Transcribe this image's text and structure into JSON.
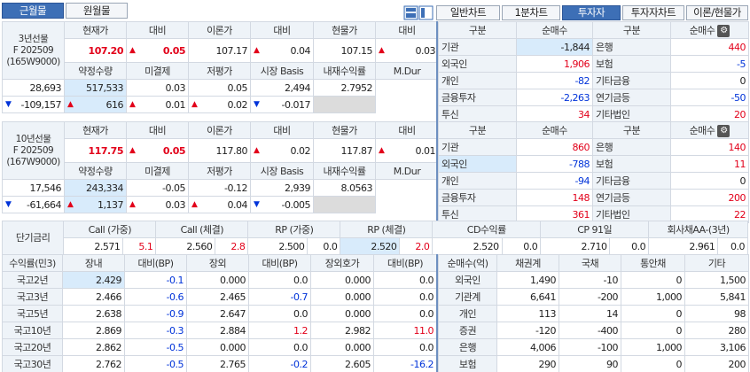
{
  "tabs": {
    "left": [
      "근월물",
      "원월물"
    ],
    "right": [
      "일반차트",
      "1분차트",
      "투자자",
      "투자자차트",
      "이론/현물가"
    ]
  },
  "sec1": {
    "name": "3년선물",
    "sub1": "F 202509",
    "sub2": "(165W9000)",
    "h1": [
      "현재가",
      "대비",
      "이론가",
      "대비",
      "현물가",
      "대비"
    ],
    "r1": [
      "107.20",
      "0.05",
      "107.17",
      "0.04",
      "107.15",
      "0.03"
    ],
    "h2": [
      "약정수량",
      "미결제",
      "저평가",
      "시장 Basis",
      "내재수익률",
      "M.Dur"
    ],
    "r2": [
      "28,693",
      "517,533",
      "0.03",
      "0.05",
      "2,494",
      "2.7952"
    ],
    "r3": [
      "-109,157",
      "616",
      "0.01",
      "0.02",
      "-0.017",
      ""
    ],
    "inv_h": [
      "구분",
      "순매수",
      "구분",
      "순매수"
    ],
    "inv": [
      [
        "기관",
        "-1,844",
        "은행",
        "440"
      ],
      [
        "외국인",
        "1,906",
        "보험",
        "-5"
      ],
      [
        "개인",
        "-82",
        "기타금융",
        "0"
      ],
      [
        "금융투자",
        "-2,263",
        "연기금등",
        "-50"
      ],
      [
        "투신",
        "34",
        "기타법인",
        "20"
      ]
    ]
  },
  "sec2": {
    "name": "10년선물",
    "sub1": "F 202509",
    "sub2": "(167W9000)",
    "h1": [
      "현재가",
      "대비",
      "이론가",
      "대비",
      "현물가",
      "대비"
    ],
    "r1": [
      "117.75",
      "0.05",
      "117.80",
      "0.02",
      "117.87",
      "0.01"
    ],
    "h2": [
      "약정수량",
      "미결제",
      "저평가",
      "시장 Basis",
      "내재수익률",
      "M.Dur"
    ],
    "r2": [
      "17,546",
      "243,334",
      "-0.05",
      "-0.12",
      "2,939",
      "8.0563"
    ],
    "r3": [
      "-61,664",
      "1,137",
      "0.03",
      "0.04",
      "-0.005",
      ""
    ],
    "inv_h": [
      "구분",
      "순매수",
      "구분",
      "순매수"
    ],
    "inv": [
      [
        "기관",
        "860",
        "은행",
        "140"
      ],
      [
        "외국인",
        "-788",
        "보험",
        "11"
      ],
      [
        "개인",
        "-94",
        "기타금융",
        "0"
      ],
      [
        "금융투자",
        "148",
        "연기금등",
        "200"
      ],
      [
        "투신",
        "361",
        "기타법인",
        "22"
      ]
    ]
  },
  "short": {
    "label": "단기금리",
    "h": [
      "Call (가중)",
      "Call (체결)",
      "RP (가중)",
      "RP (체결)",
      "CD수익률",
      "CP 91일",
      "회사채AA-(3년)"
    ],
    "v": [
      [
        "2.571",
        "5.1"
      ],
      [
        "2.560",
        "2.8"
      ],
      [
        "2.500",
        "0.0"
      ],
      [
        "2.520",
        "2.0"
      ],
      [
        "2.520",
        "0.0"
      ],
      [
        "2.710",
        "0.0"
      ],
      [
        "2.961",
        "0.0"
      ]
    ]
  },
  "bond": {
    "h": [
      "수익률(민3)",
      "장내",
      "대비(BP)",
      "장외",
      "대비(BP)",
      "장외호가",
      "대비(BP)"
    ],
    "rows": [
      [
        "국고2년",
        "2.429",
        "-0.1",
        "0.000",
        "0.0",
        "0.000",
        "0.0"
      ],
      [
        "국고3년",
        "2.466",
        "-0.6",
        "2.465",
        "-0.7",
        "0.000",
        "0.0"
      ],
      [
        "국고5년",
        "2.638",
        "-0.9",
        "2.647",
        "0.0",
        "0.000",
        "0.0"
      ],
      [
        "국고10년",
        "2.869",
        "-0.3",
        "2.884",
        "1.2",
        "2.982",
        "11.0"
      ],
      [
        "국고20년",
        "2.862",
        "-0.5",
        "0.000",
        "0.0",
        "0.000",
        "0.0"
      ],
      [
        "국고30년",
        "2.762",
        "-0.5",
        "2.765",
        "-0.2",
        "2.605",
        "-16.2"
      ]
    ]
  },
  "net": {
    "h": [
      "순매수(억)",
      "채권계",
      "국채",
      "통안채",
      "기타"
    ],
    "rows": [
      [
        "외국인",
        "1,490",
        "-10",
        "0",
        "1,500"
      ],
      [
        "기관계",
        "6,641",
        "-200",
        "1,000",
        "5,841"
      ],
      [
        "개인",
        "113",
        "14",
        "0",
        "98"
      ],
      [
        "증권",
        "-120",
        "-400",
        "0",
        "280"
      ],
      [
        "은행",
        "4,006",
        "-100",
        "1,000",
        "3,106"
      ],
      [
        "보험",
        "290",
        "90",
        "0",
        "200"
      ]
    ]
  }
}
